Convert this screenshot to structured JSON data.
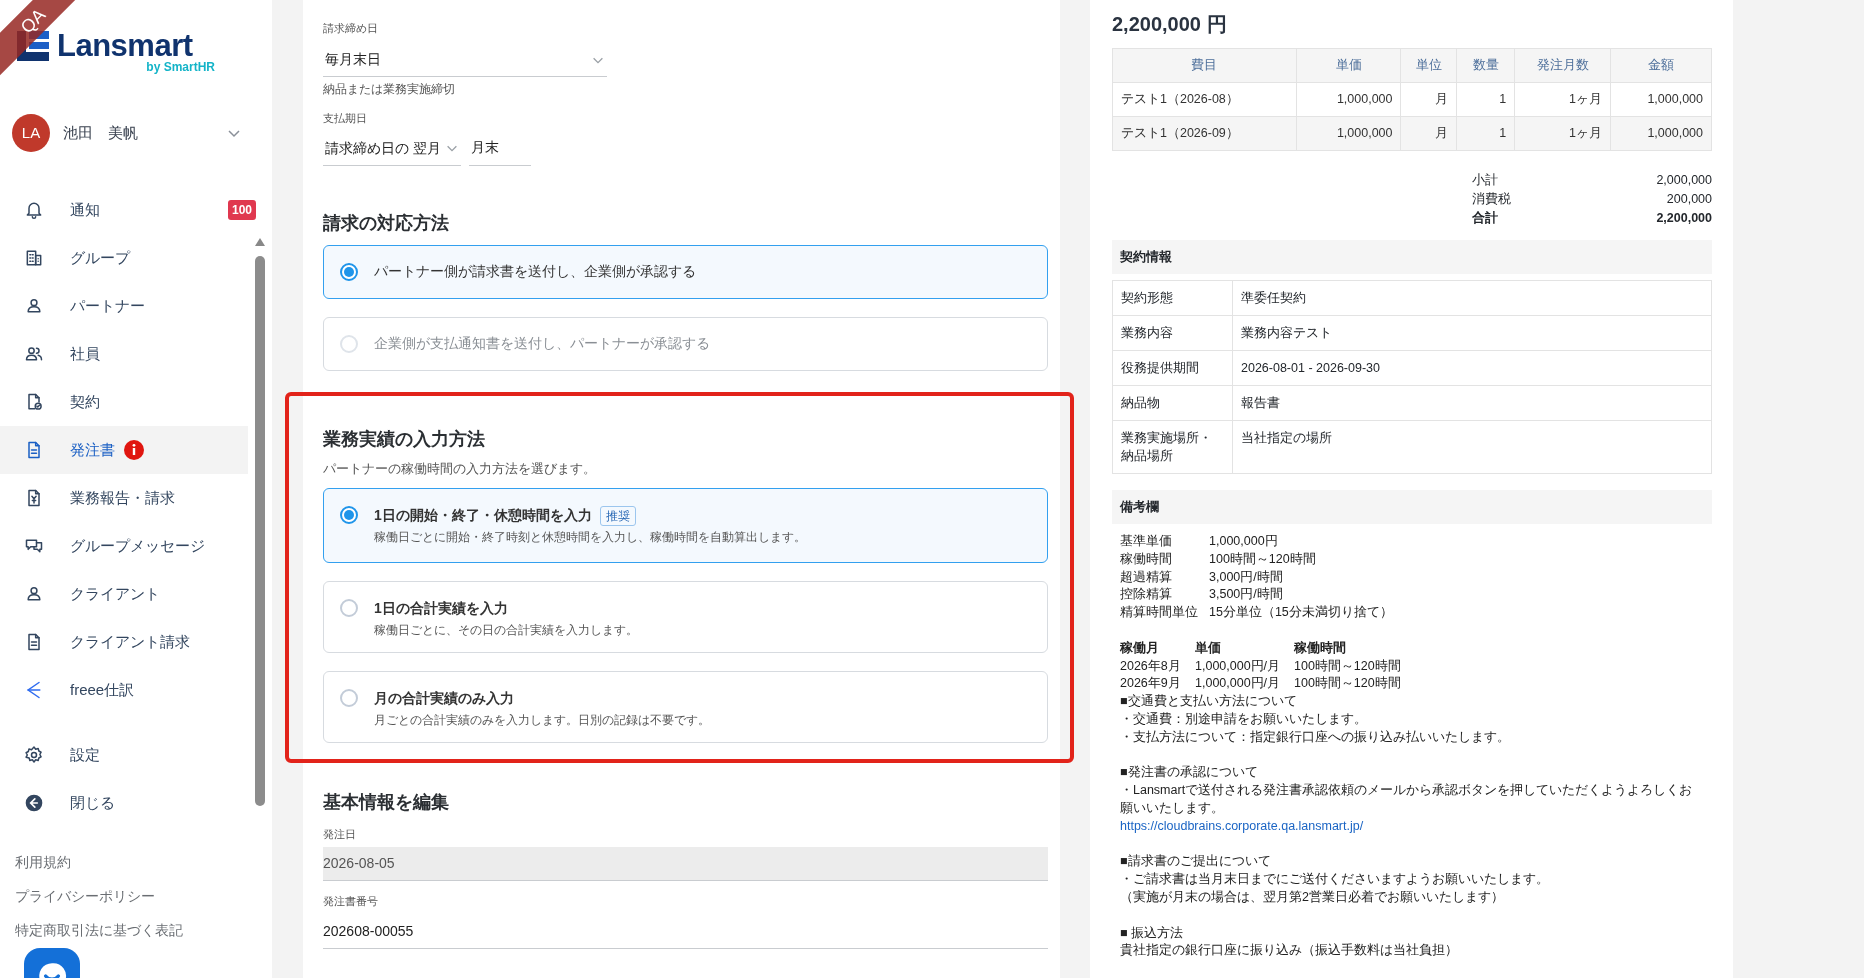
{
  "corner_ribbon": "QA",
  "brand": {
    "name": "Lansmart",
    "sub": "by SmartHR"
  },
  "user": {
    "initials": "LA",
    "name": "池田　美帆"
  },
  "nav": [
    {
      "label": "通知",
      "selected": false,
      "badge": "100"
    },
    {
      "label": "グループ",
      "selected": false
    },
    {
      "label": "パートナー",
      "selected": false
    },
    {
      "label": "社員",
      "selected": false
    },
    {
      "label": "契約",
      "selected": false
    },
    {
      "label": "発注書",
      "selected": true,
      "alert": true
    },
    {
      "label": "業務報告・請求",
      "selected": false
    },
    {
      "label": "グループメッセージ",
      "selected": false
    },
    {
      "label": "クライアント",
      "selected": false
    },
    {
      "label": "クライアント請求",
      "selected": false
    },
    {
      "label": "freee仕訳",
      "selected": false
    },
    {
      "label": "設定",
      "selected": false,
      "gap_before": true
    },
    {
      "label": "閉じる",
      "selected": false
    }
  ],
  "footer_links": [
    "利用規約",
    "プライバシーポリシー",
    "特定商取引法に基づく表記"
  ],
  "form": {
    "closing_day": {
      "label": "請求締め日",
      "value": "毎月末日",
      "help": "納品または業務実施締切"
    },
    "payment_due": {
      "label": "支払期日",
      "value": "請求締め日の 翌月",
      "day": "月末"
    },
    "billing_method": {
      "title": "請求の対応方法",
      "options": [
        {
          "label": "パートナー側が請求書を送付し、企業側が承認する",
          "selected": true,
          "disabled": false
        },
        {
          "label": "企業側が支払通知書を送付し、パートナーが承認する",
          "selected": false,
          "disabled": true
        }
      ]
    },
    "work_input": {
      "title": "業務実績の入力方法",
      "description": "パートナーの稼働時間の入力方法を選びます。",
      "highlighted": true,
      "options": [
        {
          "label": "1日の開始・終了・休憩時間を入力",
          "tag": "推奨",
          "description": "稼働日ごとに開始・終了時刻と休憩時間を入力し、稼働時間を自動算出します。",
          "selected": true
        },
        {
          "label": "1日の合計実績を入力",
          "description": "稼働日ごとに、その日の合計実績を入力します。",
          "selected": false
        },
        {
          "label": "月の合計実績のみ入力",
          "description": "月ごとの合計実績のみを入力します。日別の記録は不要です。",
          "selected": false
        }
      ]
    },
    "basic_info": {
      "title": "基本情報を編集",
      "fields": [
        {
          "label": "発注日",
          "value": "2026-08-05",
          "disabled": true
        },
        {
          "label": "発注書番号",
          "value": "202608-00055",
          "disabled": false
        }
      ]
    }
  },
  "summary": {
    "total": "2,200,000 円",
    "table": {
      "columns": [
        "費目",
        "単価",
        "単位",
        "数量",
        "発注月数",
        "金額"
      ],
      "rows": [
        [
          "テスト1（2026-08）",
          "1,000,000",
          "月",
          "1",
          "1ヶ月",
          "1,000,000"
        ],
        [
          "テスト1（2026-09）",
          "1,000,000",
          "月",
          "1",
          "1ヶ月",
          "1,000,000"
        ]
      ]
    },
    "totals": [
      {
        "label": "小計",
        "value": "2,000,000",
        "bold": false
      },
      {
        "label": "消費税",
        "value": "200,000",
        "bold": false
      },
      {
        "label": "合計",
        "value": "2,200,000",
        "bold": true
      }
    ],
    "contract": {
      "title": "契約情報",
      "rows": [
        {
          "label": "契約形態",
          "value": "準委任契約"
        },
        {
          "label": "業務内容",
          "value": "業務内容テスト"
        },
        {
          "label": "役務提供期間",
          "value": "2026-08-01 - 2026-09-30"
        },
        {
          "label": "納品物",
          "value": "報告書"
        },
        {
          "label": "業務実施場所・納品場所",
          "value": "当社指定の場所"
        }
      ]
    },
    "notes": {
      "title": "備考欄",
      "items": [
        {
          "kind": "pair",
          "cells": [
            "基準単価",
            "1,000,000円"
          ]
        },
        {
          "kind": "pair",
          "cells": [
            "稼働時間",
            "100時間～120時間"
          ]
        },
        {
          "kind": "pair",
          "cells": [
            "超過精算",
            "3,000円/時間"
          ]
        },
        {
          "kind": "pair",
          "cells": [
            "控除精算",
            "3,500円/時間"
          ]
        },
        {
          "kind": "pair",
          "cells": [
            "精算時間単位",
            "15分単位（15分未満切り捨て）"
          ]
        },
        {
          "kind": "grid_head",
          "cells": [
            "稼働月",
            "単価",
            "稼働時間"
          ],
          "gap_before": true
        },
        {
          "kind": "grid_row",
          "cells": [
            "2026年8月",
            "1,000,000円/月",
            "100時間～120時間"
          ]
        },
        {
          "kind": "grid_row",
          "cells": [
            "2026年9月",
            "1,000,000円/月",
            "100時間～120時間"
          ]
        },
        {
          "kind": "text",
          "text": "■交通費と支払い方法について"
        },
        {
          "kind": "text",
          "text": "・交通費：別途申請をお願いいたします。"
        },
        {
          "kind": "text",
          "text": "・支払方法について：指定銀行口座への振り込み払いいたします。"
        },
        {
          "kind": "text",
          "text": "■発注書の承認について",
          "gap_before": true
        },
        {
          "kind": "text",
          "text": "・Lansmartで送付される発注書承認依頼のメールから承認ボタンを押していただくようよろしくお願いいたします。"
        },
        {
          "kind": "link",
          "text": "https://cloudbrains.corporate.qa.lansmart.jp/"
        },
        {
          "kind": "text",
          "text": "■請求書のご提出について",
          "gap_before": true
        },
        {
          "kind": "text",
          "text": "・ご請求書は当月末日までにご送付くださいますようお願いいたします。"
        },
        {
          "kind": "text",
          "text": "（実施が月末の場合は、翌月第2営業日必着でお願いいたします）"
        },
        {
          "kind": "text",
          "text": "■ 振込方法",
          "gap_before": true
        },
        {
          "kind": "text",
          "text": "貴社指定の銀行口座に振り込み（振込手数料は当社負担）"
        }
      ]
    }
  }
}
